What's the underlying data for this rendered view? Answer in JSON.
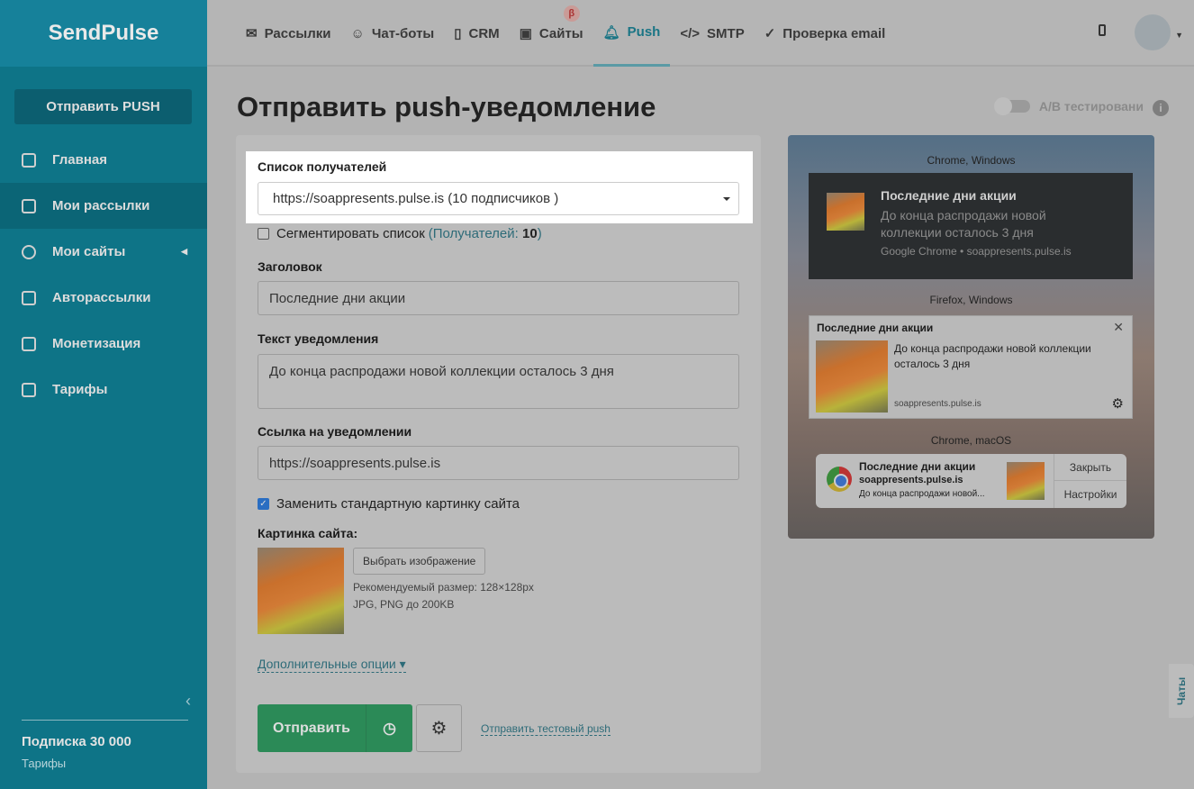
{
  "brand": "SendPulse",
  "sidebar": {
    "send_button": "Отправить PUSH",
    "items": [
      {
        "label": "Главная"
      },
      {
        "label": "Мои рассылки"
      },
      {
        "label": "Мои сайты"
      },
      {
        "label": "Авторассылки"
      },
      {
        "label": "Монетизация"
      },
      {
        "label": "Тарифы"
      }
    ],
    "plan": "Подписка 30 000",
    "plan_link": "Тарифы"
  },
  "topnav": {
    "tabs": [
      {
        "label": "Рассылки"
      },
      {
        "label": "Чат-боты"
      },
      {
        "label": "CRM"
      },
      {
        "label": "Сайты"
      },
      {
        "label": "Push"
      },
      {
        "label": "SMTP"
      },
      {
        "label": "Проверка email"
      }
    ],
    "beta": "β"
  },
  "page": {
    "title": "Отправить push-уведомление",
    "ab_label": "A/B тестировани",
    "info": "i"
  },
  "form": {
    "recipients_label": "Список получателей",
    "recipients_value": "https://soappresents.pulse.is (10 подписчиков )",
    "segment_label": "Сегментировать список",
    "segment_count_prefix": "(Получателей: ",
    "segment_count": "10",
    "segment_count_suffix": ")",
    "title_label": "Заголовок",
    "title_value": "Последние дни акции",
    "text_label": "Текст уведомления",
    "text_value": "До конца распродажи новой коллекции осталось 3 дня",
    "link_label": "Ссылка на уведомлении",
    "link_value": "https://soappresents.pulse.is",
    "replace_image_label": "Заменить стандартную картинку сайта",
    "image_label": "Картинка сайта:",
    "choose_image": "Выбрать изображение",
    "hint_size": "Рекомендуемый размер: 128×128px",
    "hint_format": "JPG, PNG до 200KB",
    "more_options": "Дополнительные опции ▾",
    "send": "Отправить",
    "test_push": "Отправить тестовый push"
  },
  "preview": {
    "chrome_windows": {
      "caption": "Chrome, Windows",
      "title": "Последние дни акции",
      "message": "До конца распродажи новой коллекции осталось 3 дня",
      "source": "Google Chrome • soappresents.pulse.is"
    },
    "firefox_windows": {
      "caption": "Firefox, Windows",
      "title": "Последние дни акции",
      "message": "До конца распродажи новой коллекции осталось 3 дня",
      "source": "soappresents.pulse.is"
    },
    "chrome_macos": {
      "caption": "Chrome, macOS",
      "title": "Последние дни акции",
      "domain": "soappresents.pulse.is",
      "message": "До конца распродажи новой...",
      "close": "Закрыть",
      "settings": "Настройки"
    }
  },
  "chats": "Чаты"
}
